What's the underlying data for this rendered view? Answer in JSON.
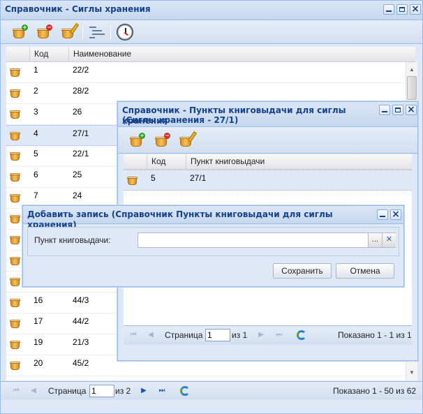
{
  "main_window": {
    "title": "Справочник - Сиглы хранения",
    "columns": {
      "code": "Код",
      "name": "Наименование"
    },
    "rows": [
      {
        "code": "1",
        "name": "22/2"
      },
      {
        "code": "2",
        "name": "28/2"
      },
      {
        "code": "3",
        "name": "26"
      },
      {
        "code": "4",
        "name": "27/1"
      },
      {
        "code": "5",
        "name": "22/1"
      },
      {
        "code": "6",
        "name": "25"
      },
      {
        "code": "7",
        "name": "24"
      },
      {
        "code": "",
        "name": ""
      },
      {
        "code": "",
        "name": ""
      },
      {
        "code": "",
        "name": ""
      },
      {
        "code": "",
        "name": ""
      },
      {
        "code": "16",
        "name": "44/3"
      },
      {
        "code": "17",
        "name": "44/2"
      },
      {
        "code": "19",
        "name": "21/3"
      },
      {
        "code": "20",
        "name": "45/2"
      }
    ],
    "selected_row": 3,
    "paging": {
      "page_label": "Страница",
      "page_value": "1",
      "of_label": "из 2",
      "shown": "Показано 1 - 50 из 62"
    }
  },
  "points_window": {
    "title_line1": "Справочник - Пункты книговыдачи для сиглы хранения",
    "title_line2": "(Сиглы хранения - 27/1)",
    "columns": {
      "code": "Код",
      "point": "Пункт книговыдачи"
    },
    "rows": [
      {
        "code": "5",
        "point": "27/1"
      }
    ],
    "paging": {
      "page_label": "Страница",
      "page_value": "1",
      "of_label": "из 1",
      "shown": "Показано 1 - 1 из 1"
    }
  },
  "add_dialog": {
    "title": "Добавить запись (Справочник Пункты книговыдачи для сиглы хранения)",
    "field_label": "Пункт книговыдачи:",
    "field_value": "",
    "trigger_select": "...",
    "trigger_clear": "✕",
    "save_label": "Сохранить",
    "cancel_label": "Отмена"
  },
  "icons": {
    "add": "basket-add-icon",
    "delete": "basket-delete-icon",
    "edit": "basket-edit-icon",
    "list": "list-icon",
    "history": "clock-icon",
    "refresh": "refresh-icon"
  },
  "colors": {
    "header_bg": "#c6d7ee",
    "title_text": "#15428b",
    "border": "#99bbe8",
    "selected_row": "#dfe8f6"
  }
}
